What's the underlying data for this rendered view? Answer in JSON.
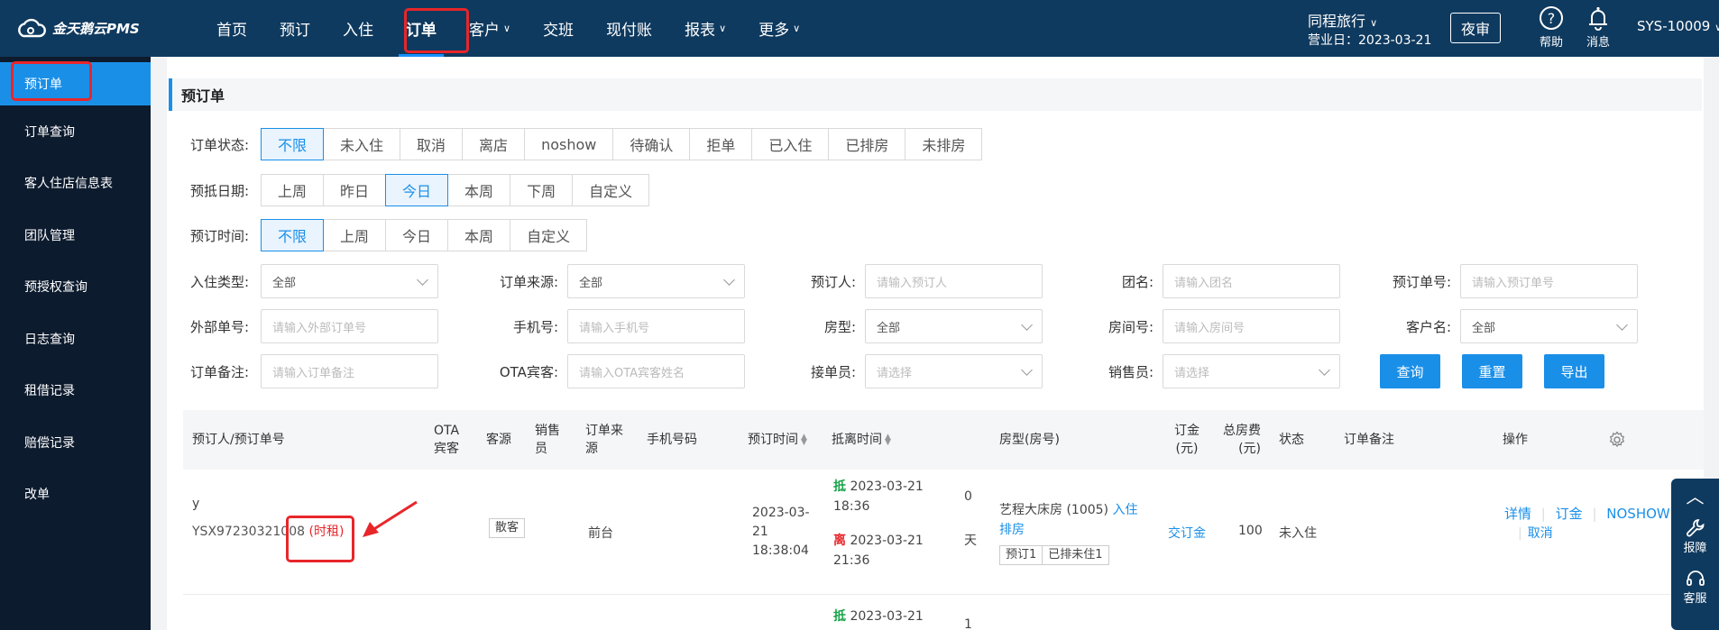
{
  "app": {
    "logo_text": "金天鹅云PMS"
  },
  "nav": [
    "首页",
    "预订",
    "入住",
    "订单",
    "客户",
    "交班",
    "现付账",
    "报表",
    "更多"
  ],
  "header": {
    "hotel": "同程旅行",
    "business_date": "营业日：2023-03-21",
    "night_audit": "夜审",
    "help": "帮助",
    "messages": "消息",
    "user": "SYS-10009"
  },
  "sidebar": [
    "预订单",
    "订单查询",
    "客人住店信息表",
    "团队管理",
    "预授权查询",
    "日志查询",
    "租借记录",
    "赔偿记录",
    "改单"
  ],
  "page_title": "预订单",
  "filters": {
    "status_label": "订单状态:",
    "status_options": [
      "不限",
      "未入住",
      "取消",
      "离店",
      "noshow",
      "待确认",
      "拒单",
      "已入住",
      "已排房",
      "未排房"
    ],
    "arrival_label": "预抵日期:",
    "arrival_options": [
      "上周",
      "昨日",
      "今日",
      "本周",
      "下周",
      "自定义"
    ],
    "booking_label": "预订时间:",
    "booking_options": [
      "不限",
      "上周",
      "今日",
      "本周",
      "自定义"
    ]
  },
  "fields": {
    "checkin_type": {
      "label": "入住类型:",
      "value": "全部"
    },
    "order_source": {
      "label": "订单来源:",
      "value": "全部"
    },
    "booker": {
      "label": "预订人:",
      "placeholder": "请输入预订人"
    },
    "group": {
      "label": "团名:",
      "placeholder": "请输入团名"
    },
    "order_no": {
      "label": "预订单号:",
      "placeholder": "请输入预订单号"
    },
    "ext_no": {
      "label": "外部单号:",
      "placeholder": "请输入外部订单号"
    },
    "phone": {
      "label": "手机号:",
      "placeholder": "请输入手机号"
    },
    "room_type": {
      "label": "房型:",
      "value": "全部"
    },
    "room_no": {
      "label": "房间号:",
      "placeholder": "请输入房间号"
    },
    "customer": {
      "label": "客户名:",
      "value": "全部"
    },
    "remark": {
      "label": "订单备注:",
      "placeholder": "请输入订单备注"
    },
    "ota_guest": {
      "label": "OTA宾客:",
      "placeholder": "请输入OTA宾客姓名"
    },
    "receiver": {
      "label": "接单员:",
      "placeholder": "请选择"
    },
    "sales": {
      "label": "销售员:",
      "placeholder": "请选择"
    }
  },
  "buttons": {
    "query": "查询",
    "reset": "重置",
    "export": "导出"
  },
  "table": {
    "headers": {
      "booker_order": "预订人/预订单号",
      "ota_guest": "OTA宾客",
      "source": "客源",
      "sales": "销售员",
      "order_source": "订单来源",
      "phone": "手机号码",
      "book_time": "预订时间",
      "arrive_leave": "抵离时间",
      "room": "房型(房号)",
      "deposit": "订金(元)",
      "total": "总房费(元)",
      "status": "状态",
      "remark": "订单备注",
      "ops": "操作"
    },
    "rows": [
      {
        "booker": "y",
        "order_no": "YSX9723032100",
        "order_no_tail": "8",
        "hourly_tag": "(时租)",
        "source": "散客",
        "order_source": "前台",
        "book_time_date": "2023-03-",
        "book_time_day": "21",
        "book_time_clock": "18:38:04",
        "arrive_tag": "抵",
        "arrive_date": "2023-03-21",
        "arrive_clock": "18:36",
        "leave_tag": "离",
        "leave_date": "2023-03-21",
        "leave_clock": "21:36",
        "nights_num": "0",
        "nights_unit": "天",
        "room": "艺程大床房 (1005)",
        "room_action": "入住",
        "room_action2": "排房",
        "badge1": "预订1",
        "badge2": "已排未住1",
        "deposit_link": "交订金",
        "total": "100",
        "status": "未入住",
        "op_detail": "详情",
        "op_deposit": "订金",
        "op_noshow": "NOSHOW",
        "op_cancel": "取消"
      },
      {
        "arrive_tag": "抵",
        "arrive_date": "2023-03-21",
        "nights_num": "1"
      }
    ]
  },
  "floatbar": {
    "report": "报障",
    "service": "客服"
  }
}
